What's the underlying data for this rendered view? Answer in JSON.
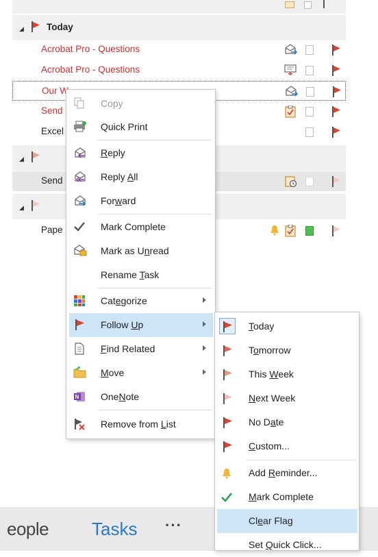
{
  "groups": {
    "today": "Today"
  },
  "tasks": [
    {
      "subject": "Acrobat Pro - Questions"
    },
    {
      "subject": "Acrobat Pro - Questions"
    },
    {
      "subject": "Our W"
    },
    {
      "subject": "Send"
    },
    {
      "subject": "Excel"
    },
    {
      "subject": "Send"
    },
    {
      "subject": "Pape"
    }
  ],
  "context_menu": {
    "copy": "Copy",
    "quick_print": "Quick Print",
    "reply": "Reply",
    "reply_all": "Reply All",
    "forward": "Forward",
    "mark_complete": "Mark Complete",
    "mark_unread": "Mark as Unread",
    "rename_task": "Rename Task",
    "categorize": "Categorize",
    "follow_up": "Follow Up",
    "find_related": "Find Related",
    "move": "Move",
    "onenote": "OneNote",
    "remove_from_list": "Remove from List"
  },
  "followup_submenu": {
    "today": "Today",
    "tomorrow": "Tomorrow",
    "this_week": "This Week",
    "next_week": "Next Week",
    "no_date": "No Date",
    "custom": "Custom...",
    "add_reminder": "Add Reminder...",
    "mark_complete": "Mark Complete",
    "clear_flag": "Clear Flag",
    "set_quick_click": "Set Quick Click..."
  },
  "bottom_nav": {
    "people": "eople",
    "tasks": "Tasks",
    "more": "···"
  },
  "colors": {
    "flag_red": "#d9442e",
    "subject_red": "#d12e2e",
    "highlight": "#cde5f7",
    "tasks_blue": "#2b79c2",
    "group_bg": "#f0f0f0",
    "check_green": "#2e9e5f"
  },
  "icons": [
    "flag-icon",
    "task-icon",
    "reply-icon",
    "forward-icon",
    "check-icon",
    "bell-icon",
    "copy-icon",
    "print-icon",
    "categorize-icon",
    "folder-icon",
    "onenote-icon",
    "remove-icon",
    "find-icon",
    "mark-unread-icon"
  ]
}
